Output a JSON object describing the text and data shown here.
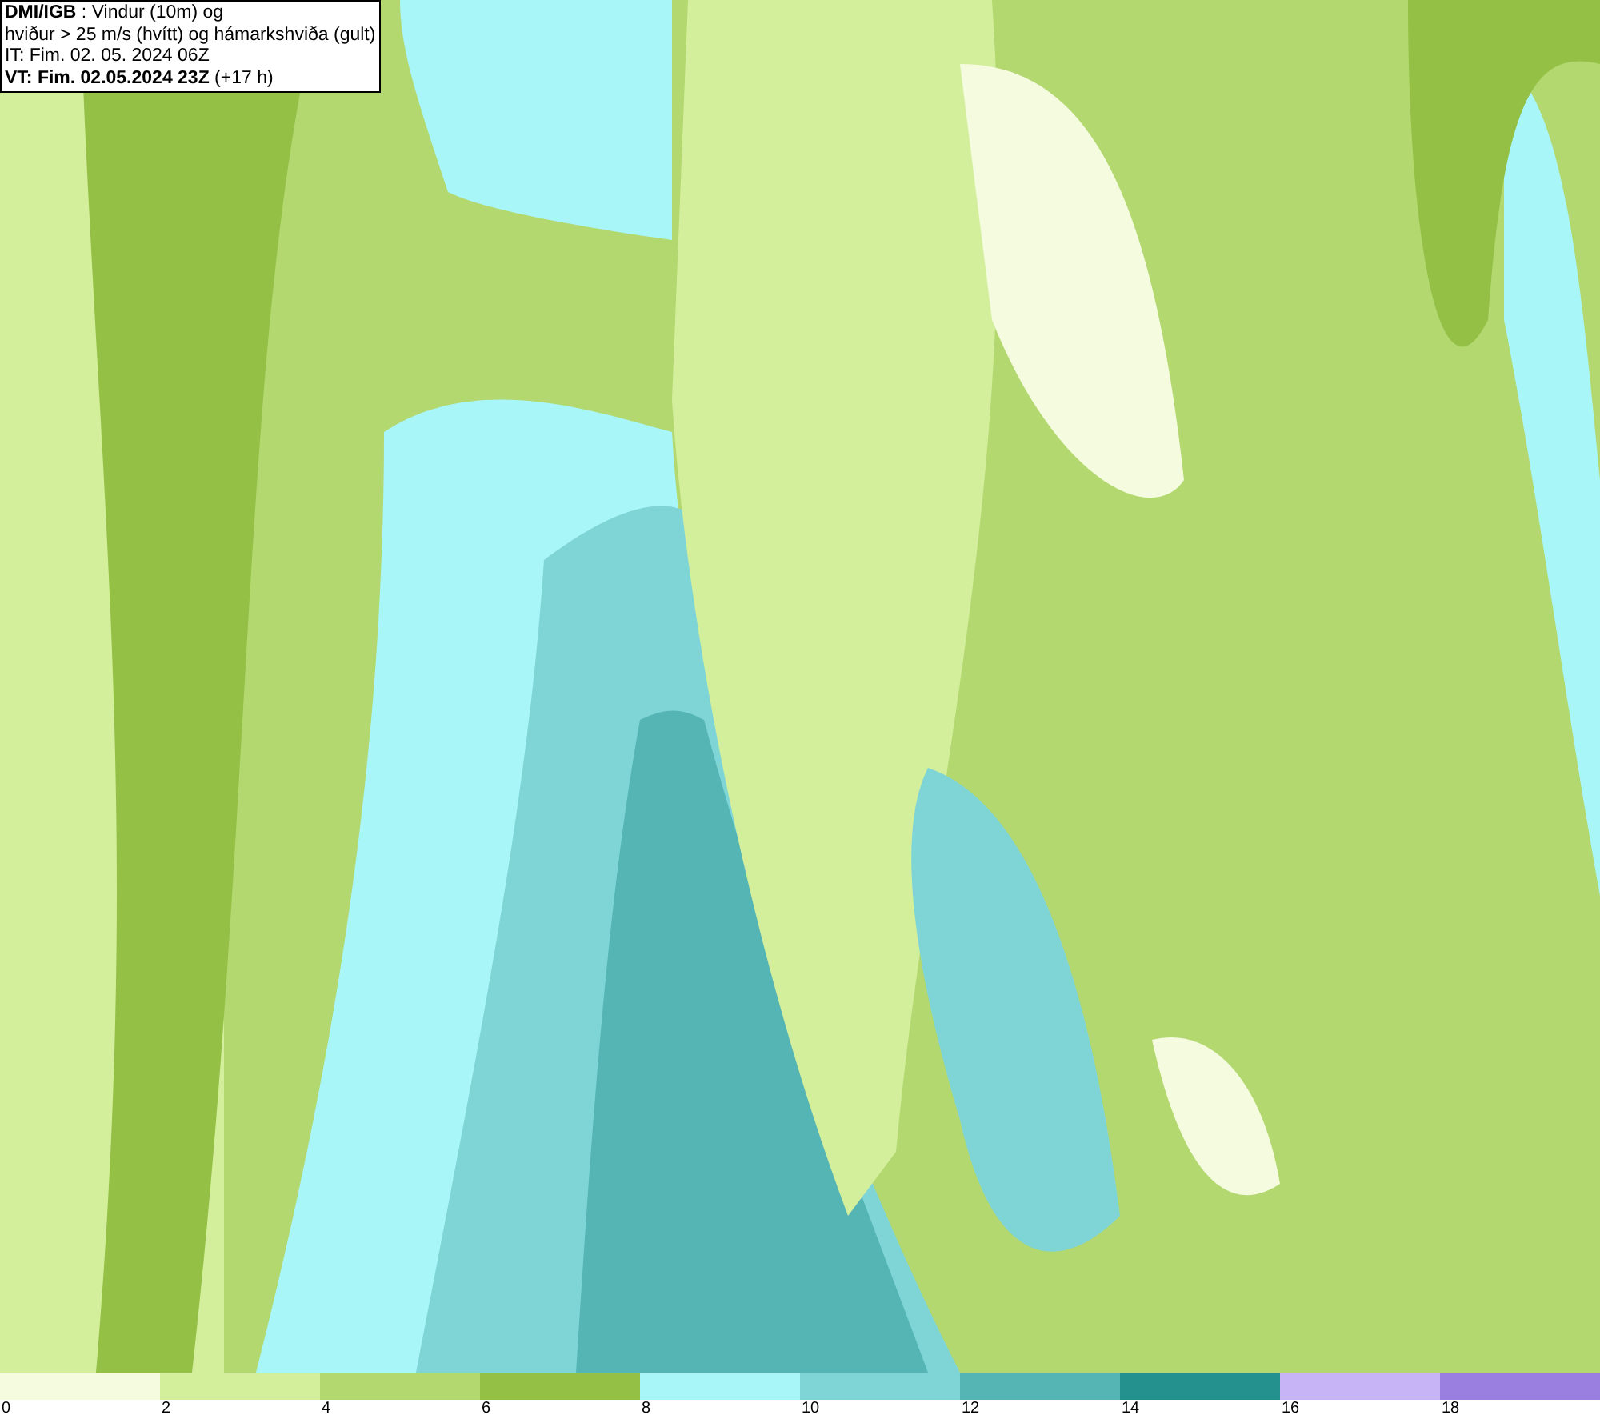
{
  "title_box": {
    "lines": [
      "**DMI/IGB** : Vindur (10m) og",
      "hviður > 25 m/s (hvítt) og hámarkshviða (gult)",
      "IT: Fim. 02. 05. 2024 06Z",
      "**VT: Fim. 02.05.2024 23Z** (+17 h)"
    ]
  },
  "legend": [
    {
      "color": "#f4fbde",
      "label": "0"
    },
    {
      "color": "#d4ef9c",
      "label": "2"
    },
    {
      "color": "#b3d870",
      "label": "4"
    },
    {
      "color": "#93c045",
      "label": "6"
    },
    {
      "color": "#a9f6f8",
      "label": "8"
    },
    {
      "color": "#7fd5d6",
      "label": "10"
    },
    {
      "color": "#55b5b5",
      "label": "12"
    },
    {
      "color": "#24918f",
      "label": "14"
    },
    {
      "color": "#c6b4f6",
      "label": "16"
    },
    {
      "color": "#9a7fe0",
      "label": "18"
    }
  ]
}
